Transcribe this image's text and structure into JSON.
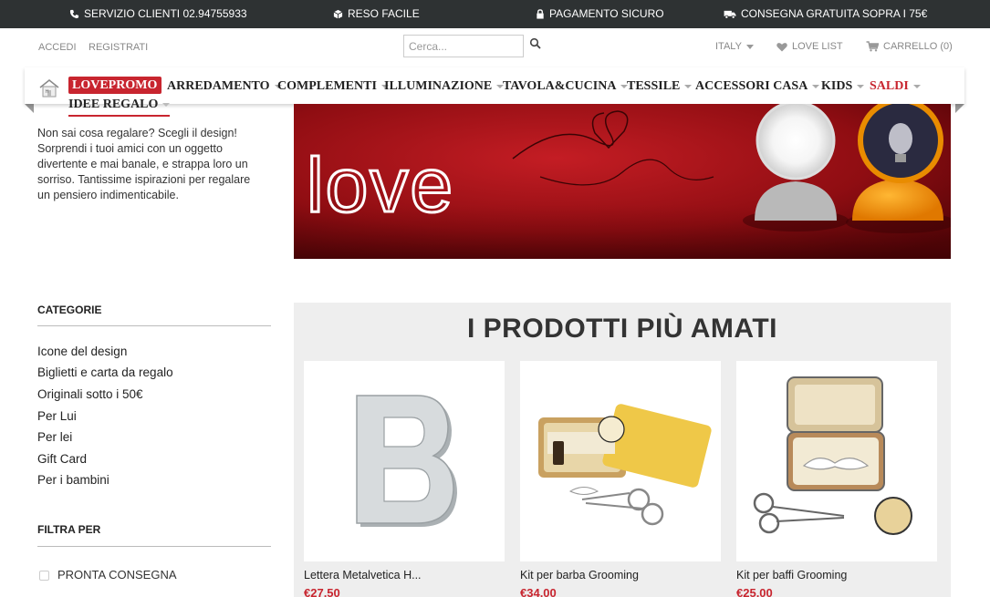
{
  "topbar": {
    "service": "SERVIZIO CLIENTI 02.94755933",
    "returns": "RESO FACILE",
    "payment": "PAGAMENTO SICURO",
    "shipping": "CONSEGNA GRATUITA SOPRA I 75€"
  },
  "header": {
    "login": "ACCEDI",
    "register": "REGISTRATI",
    "search_placeholder": "Cerca...",
    "country": "ITALY",
    "love_list": "LOVE LIST",
    "cart": "CARRELLO (0)"
  },
  "nav": {
    "promo": "LOVEPROMO",
    "items": [
      "ARREDAMENTO",
      "COMPLEMENTI",
      "ILLUMINAZIONE",
      "TAVOLA&CUCINA",
      "TESSILE",
      "ACCESSORI CASA",
      "KIDS"
    ],
    "saldi": "SALDI",
    "current": "IDEE REGALO"
  },
  "intro": "Non sai cosa regalare? Scegli il design! Sorprendi i tuoi amici con un oggetto divertente e mai banale, e strappa loro un sorriso. Tantissime ispirazioni per regalare un pensiero indimenticabile.",
  "banner": {
    "word": "love"
  },
  "sidebar": {
    "categories_title": "CATEGORIE",
    "categories": [
      "Icone del design",
      "Biglietti e carta da regalo",
      "Originali sotto i 50€",
      "Per Lui",
      "Per lei",
      "Gift Card",
      "Per i bambini"
    ],
    "filter_title": "FILTRA PER",
    "filter_option": "PRONTA CONSEGNA"
  },
  "products": {
    "title": "I PRODOTTI PIÙ AMATI",
    "items": [
      {
        "name": "Lettera Metalvetica H...",
        "price": "€27,50"
      },
      {
        "name": "Kit per barba Grooming",
        "price": "€34,00"
      },
      {
        "name": "Kit per baffi Grooming",
        "price": "€25,00"
      }
    ]
  },
  "colors": {
    "accent": "#c8252f",
    "topbar": "#2e3233",
    "panel": "#eeeeee"
  }
}
